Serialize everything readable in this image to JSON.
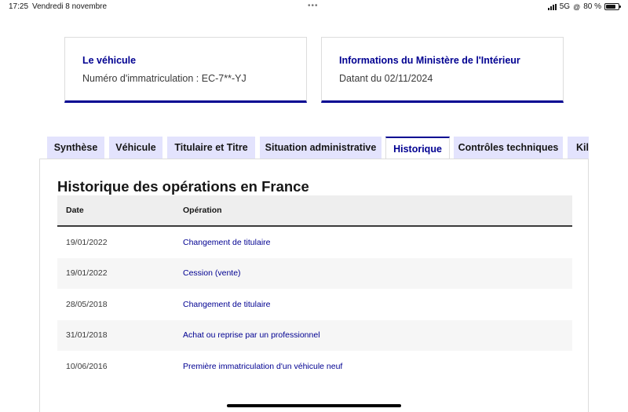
{
  "statusbar": {
    "time": "17:25",
    "date": "Vendredi 8 novembre",
    "network": "5G",
    "battery": "80 %",
    "battery_level": 0.8
  },
  "cards": {
    "vehicle": {
      "title": "Le véhicule",
      "text": "Numéro d'immatriculation : EC-7**-YJ"
    },
    "ministry": {
      "title": "Informations du Ministère de l'Intérieur",
      "text": "Datant du 02/11/2024"
    }
  },
  "tabs": [
    {
      "label": "Synthèse",
      "active": false
    },
    {
      "label": "Véhicule",
      "active": false
    },
    {
      "label": "Titulaire et Titre",
      "active": false
    },
    {
      "label": "Situation administrative",
      "active": false
    },
    {
      "label": "Historique",
      "active": true
    },
    {
      "label": "Contrôles techniques",
      "active": false
    },
    {
      "label": "Kilométrage",
      "active": false
    }
  ],
  "history": {
    "title": "Historique des opérations en France",
    "columns": {
      "date": "Date",
      "operation": "Opération"
    },
    "rows": [
      {
        "date": "19/01/2022",
        "operation": "Changement de titulaire"
      },
      {
        "date": "19/01/2022",
        "operation": "Cession (vente)"
      },
      {
        "date": "28/05/2018",
        "operation": "Changement de titulaire"
      },
      {
        "date": "31/01/2018",
        "operation": "Achat ou reprise par un professionnel"
      },
      {
        "date": "10/06/2016",
        "operation": "Première immatriculation d'un véhicule neuf"
      }
    ]
  },
  "colors": {
    "accent": "#000091",
    "tab_background": "#e3e3fd"
  }
}
